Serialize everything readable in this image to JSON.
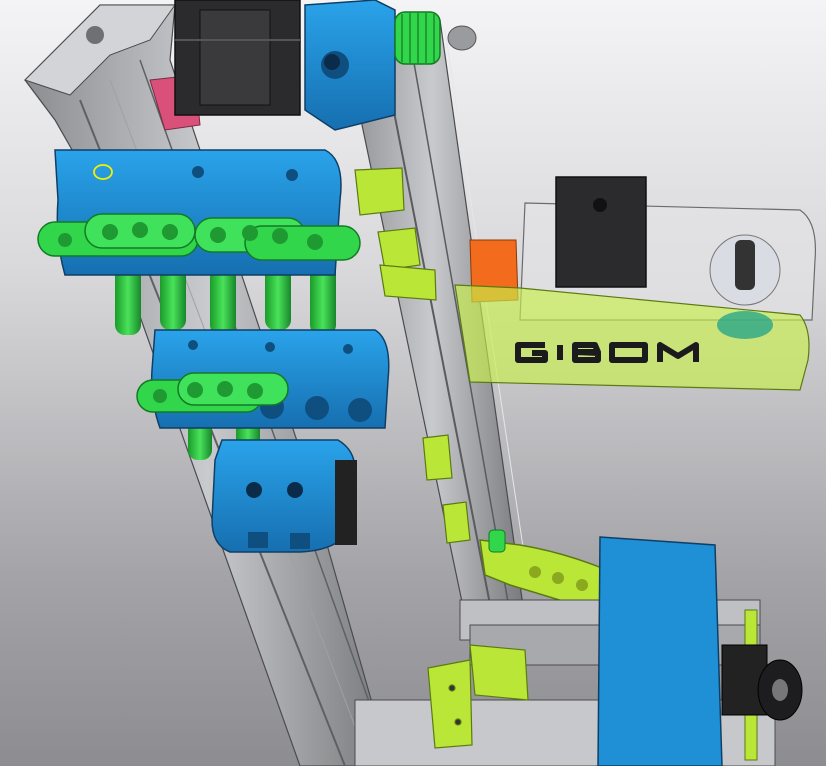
{
  "viewport": {
    "background_top": "#f4f4f6",
    "background_bottom": "#8d8d91"
  },
  "colors": {
    "extrusion": "#b7b8bb",
    "extrusion_dark": "#6f7074",
    "bracket_blue": "#1f8fd6",
    "rod_green": "#2bc83a",
    "clip_green": "#31d64a",
    "lime": "#b9e637",
    "translucent_lime": "#c8f04a",
    "motor_black": "#2b2b2d",
    "orange": "#f36b1c",
    "pink": "#d9517a"
  },
  "model": {
    "enclosure_lettering": "GIBOM"
  }
}
